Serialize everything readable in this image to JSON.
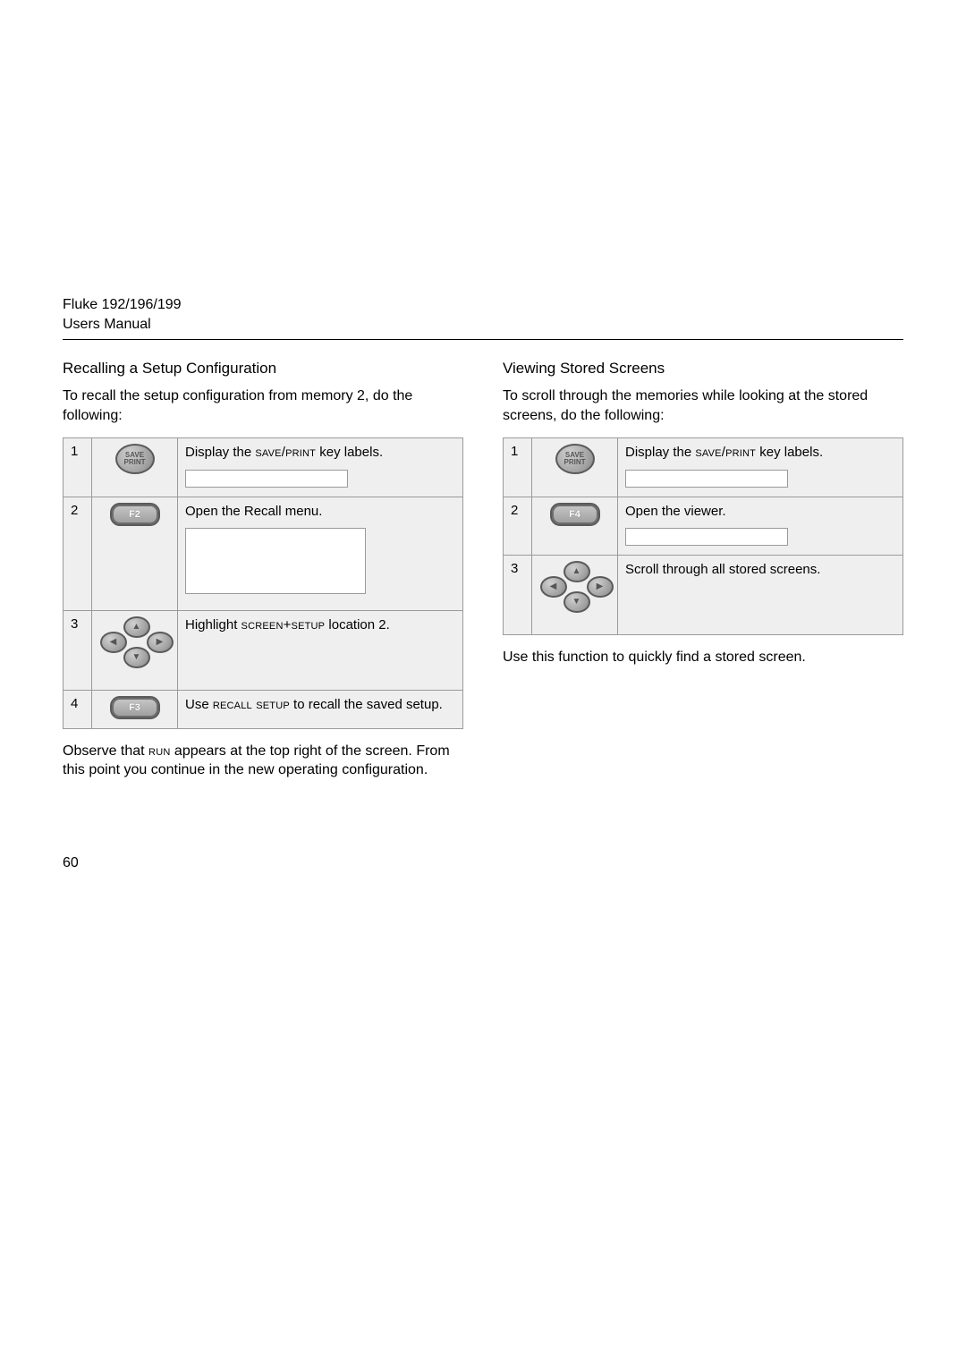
{
  "header": {
    "line1": "Fluke 192/196/199",
    "line2": "Users Manual"
  },
  "left": {
    "title": "Recalling a Setup Configuration",
    "intro": "To recall the setup configuration from memory 2, do the following:",
    "steps": [
      {
        "n": "1",
        "btn": {
          "type": "round",
          "label": "SAVE PRINT",
          "name": "save-print-key"
        },
        "text_pre": "Display the ",
        "text_sc": "save/print",
        "text_post": " key labels.",
        "extra": "save-box"
      },
      {
        "n": "2",
        "btn": {
          "type": "fkey",
          "label": "F2",
          "name": "f2-key"
        },
        "text_pre": "Open the Recall  menu.",
        "extra": "menu-box"
      },
      {
        "n": "3",
        "btn": {
          "type": "dpad",
          "name": "arrow-pad"
        },
        "text_pre": "Highlight ",
        "text_sc": "screen+setup",
        "text_post": " location 2."
      },
      {
        "n": "4",
        "btn": {
          "type": "fkey",
          "label": "F3",
          "name": "f3-key"
        },
        "text_pre": "Use ",
        "text_sc": "recall setup",
        "text_post": " to recall the saved setup."
      }
    ],
    "observe_pre": "Observe that ",
    "observe_sc": "run",
    "observe_post": " appears at the top right of the screen. From this point you continue in the new operating configuration."
  },
  "right": {
    "title": "Viewing Stored Screens",
    "intro": "To scroll through the memories while looking at the stored screens, do the following:",
    "steps": [
      {
        "n": "1",
        "btn": {
          "type": "round",
          "label": "SAVE PRINT",
          "name": "save-print-key"
        },
        "text_pre": "Display the ",
        "text_sc": "save/print",
        "text_post": " key labels.",
        "extra": "save-box"
      },
      {
        "n": "2",
        "btn": {
          "type": "fkey",
          "label": "F4",
          "name": "f4-key"
        },
        "text_pre": "Open the viewer.",
        "extra": "viewer-box"
      },
      {
        "n": "3",
        "btn": {
          "type": "dpad",
          "name": "arrow-pad"
        },
        "text_pre": "Scroll through all stored screens."
      }
    ],
    "note": "Use this function to quickly find a stored screen."
  },
  "page_number": "60"
}
